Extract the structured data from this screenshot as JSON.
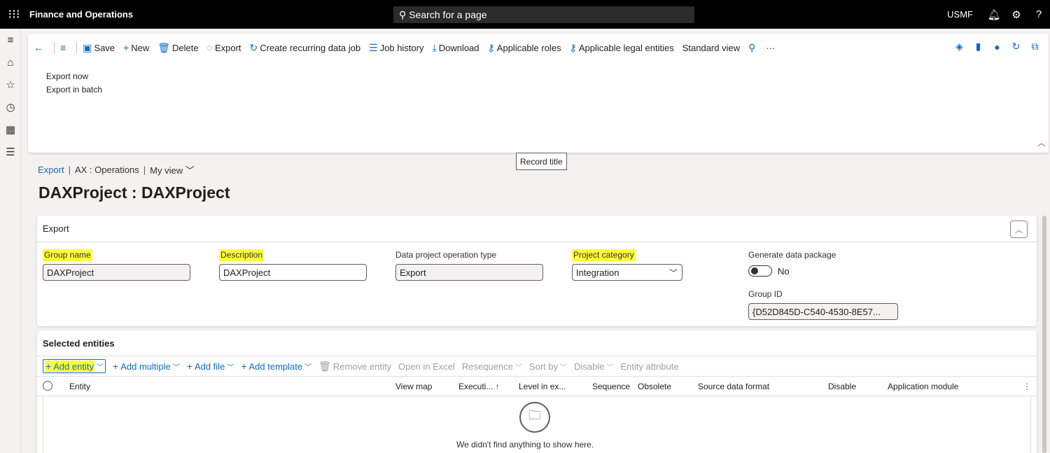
{
  "topbar": {
    "app_title": "Finance and Operations",
    "search_label": "Search for a page",
    "company": "USMF"
  },
  "action_pane": {
    "buttons": [
      {
        "label": "Save",
        "icon": "save-icon"
      },
      {
        "label": "New",
        "icon": "plus-icon"
      },
      {
        "label": "Delete",
        "icon": "trash-icon"
      },
      {
        "label": "Export",
        "icon": "export-icon"
      },
      {
        "label": "Create recurring data job",
        "icon": "recurring-icon"
      },
      {
        "label": "Job history",
        "icon": "list-icon"
      },
      {
        "label": "Download",
        "icon": "download-icon"
      },
      {
        "label": "Applicable roles",
        "icon": "key-icon"
      },
      {
        "label": "Applicable legal entities",
        "icon": "key-icon"
      },
      {
        "label": "Standard view",
        "icon": ""
      }
    ],
    "submenu": [
      "Export now",
      "Export in batch"
    ],
    "more": "···"
  },
  "tooltip": "Record title",
  "breadcrumb": {
    "link": "Export",
    "company": "AX : Operations",
    "view": "My view"
  },
  "page_title": "DAXProject : DAXProject",
  "export_card": {
    "header": "Export",
    "group_name": {
      "label": "Group name",
      "value": "DAXProject"
    },
    "description": {
      "label": "Description",
      "value": "DAXProject"
    },
    "operation_type": {
      "label": "Data project operation type",
      "value": "Export"
    },
    "project_category": {
      "label": "Project category",
      "value": "Integration"
    },
    "generate_package": {
      "label": "Generate data package",
      "value": "No"
    },
    "group_id": {
      "label": "Group ID",
      "value": "{D52D845D-C540-4530-8E57..."
    }
  },
  "entities_card": {
    "header": "Selected entities",
    "toolbar": {
      "add_entity": "Add entity",
      "add_multiple": "Add multiple",
      "add_file": "Add file",
      "add_template": "Add template",
      "remove_entity": "Remove entity",
      "open_in_excel": "Open in Excel",
      "resequence": "Resequence",
      "sort_by": "Sort by",
      "disable": "Disable",
      "entity_attribute": "Entity attribute"
    },
    "columns": {
      "entity": "Entity",
      "view_map": "View map",
      "execution": "Executi...",
      "level": "Level in ex...",
      "sequence": "Sequence",
      "obsolete": "Obsolete",
      "source_format": "Source data format",
      "disable": "Disable",
      "app_module": "Application module"
    },
    "empty_message": "We didn't find anything to show here."
  },
  "colors": {
    "accent": "#0f6cbd",
    "highlight": "#fdfd3c",
    "topbar": "#000000"
  }
}
